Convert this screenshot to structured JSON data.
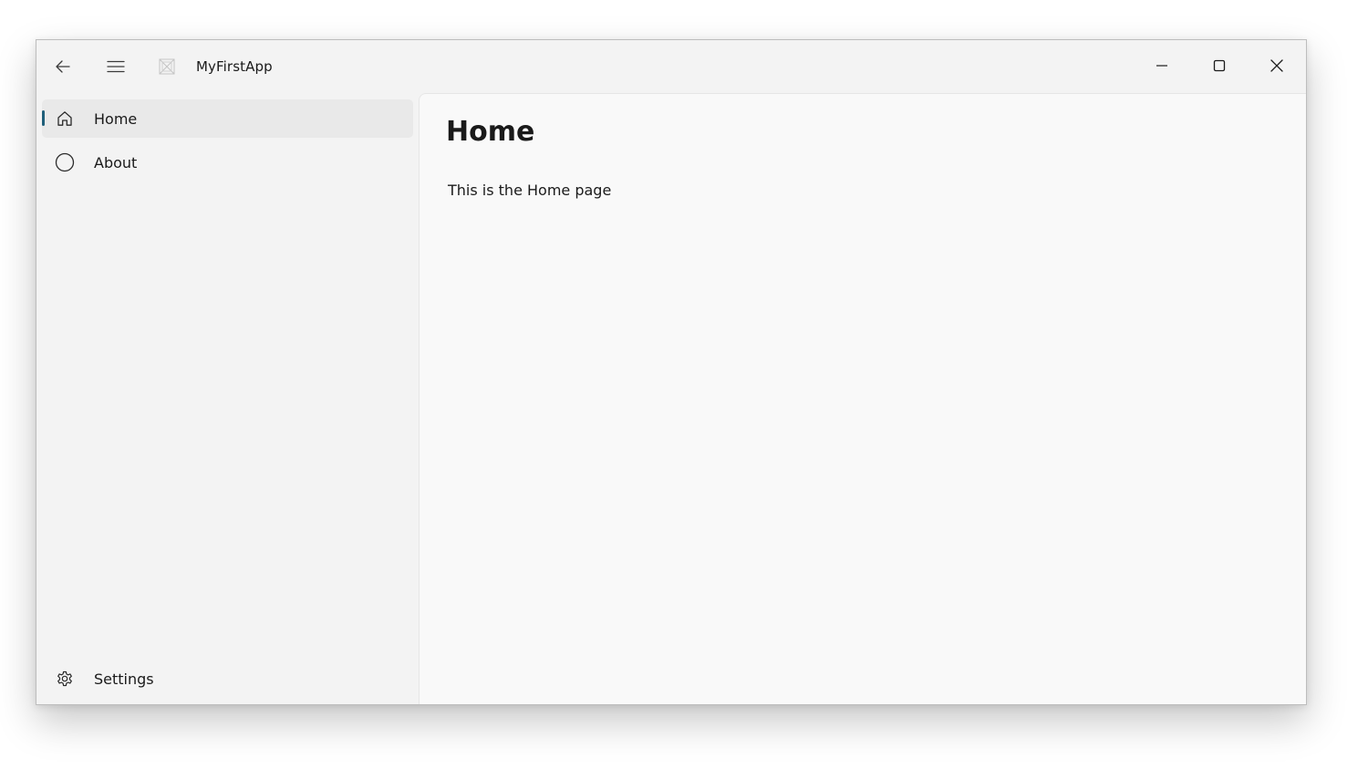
{
  "window": {
    "title": "MyFirstApp"
  },
  "titlebar": {
    "back_icon": "arrow-left-icon",
    "menu_icon": "hamburger-icon",
    "app_icon": "app-placeholder-icon",
    "minimize_icon": "minimize-icon",
    "maximize_icon": "maximize-icon",
    "close_icon": "close-icon"
  },
  "nav": {
    "items": [
      {
        "label": "Home",
        "icon": "home-icon",
        "selected": true
      },
      {
        "label": "About",
        "icon": "circle-icon",
        "selected": false
      }
    ],
    "footer": {
      "label": "Settings",
      "icon": "gear-icon"
    }
  },
  "content": {
    "title": "Home",
    "body": "This is the Home page"
  },
  "colors": {
    "accent": "#1f5f7a",
    "window_bg": "#f3f3f3",
    "content_bg": "#f9f9f9",
    "selected_bg": "#e9e9e9"
  }
}
